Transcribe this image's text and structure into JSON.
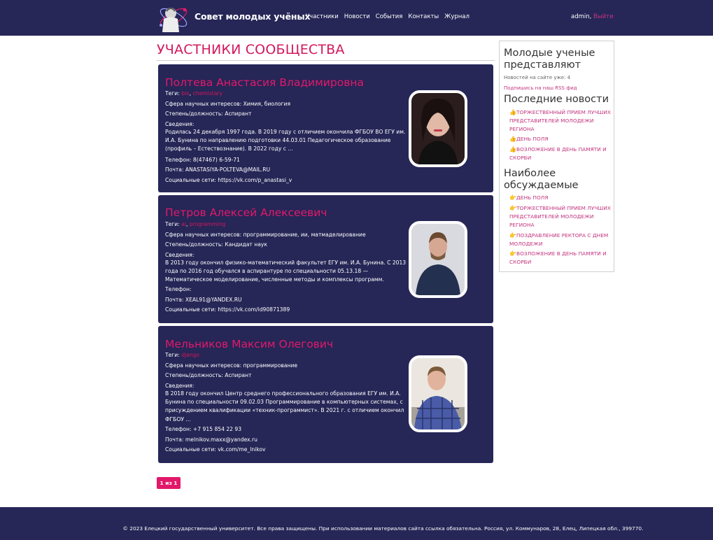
{
  "header": {
    "site_title": "Совет молодых учёных",
    "nav": [
      "Участники",
      "Новости",
      "События",
      "Контакты",
      "Журнал"
    ],
    "user_name": "admin",
    "logout_label": "Выйти"
  },
  "page_title": "УЧАСТНИКИ СООБЩЕСТВА",
  "labels": {
    "tags": "Теги:",
    "field": "Сфера научных интересов:",
    "degree": "Степень/должность:",
    "info": "Сведения:",
    "phone": "Телефон:",
    "email": "Почта:",
    "social": "Социальные сети:"
  },
  "members": [
    {
      "name": "Полтева Анастасия Владимировна",
      "tags": [
        "bio",
        "chemistary"
      ],
      "field": "Химия, биология",
      "degree": "Аспирант",
      "info": "Родилась 24 декабря 1997 года. В 2019 году с отличием окончила ФГБОУ ВО ЕГУ им. И.А. Бунина по направлению подготовки 44.03.01 Педагогическое образование (профиль – Естествознание). В 2022 году с ...",
      "phone": "8(47467) 6-59-71",
      "email": "ANASTASIYA-POLTEVA@MAIL.RU",
      "social": "https://vk.com/p_anastasi_v"
    },
    {
      "name": "Петров Алексей Алексеевич",
      "tags": [
        "ai",
        "programming"
      ],
      "field": "программирование, ии, матмаделирование",
      "degree": "Кандидат наук",
      "info": "В 2013 году окончил физико-математический факультет ЕГУ им. И.А. Бунина. С 2013 года по 2016 год обучался в аспирантуре по специальности 05.13.18 — Математическое моделирование, численные методы и комплексы программ.",
      "phone": "",
      "email": "XEAL91@YANDEX.RU",
      "social": "https://vk.com/id90871389"
    },
    {
      "name": "Мельников Максим Олегович",
      "tags": [
        "django"
      ],
      "field": "программирование",
      "degree": "Аспирант",
      "info": "В 2018 году окончил Центр среднего профессионального образования ЕГУ им. И.А. Бунина по специальности 09.02.03 Программирование в компьютерных системах, с присуждением квалификации «техник-программист». В 2021 г. с отличием окончил ФГБОУ ...",
      "phone": "+7 915 854 22 93",
      "email": "melnikov.maxx@yandex.ru",
      "social": "vk.com/me_lnikov"
    }
  ],
  "pagination": "1 из 1",
  "sidebar": {
    "heading": "Молодые ученые представляют",
    "news_count": "Новостей на сайте уже: 4",
    "rss": "Подпишись на наш RSS фид",
    "latest_heading": "Последние новости",
    "latest": [
      "ТОРЖЕСТВЕННЫЙ ПРИЕМ ЛУЧШИХ ПРЕДСТАВИТЕЛЕЙ МОЛОДЕЖИ РЕГИОНА",
      "ДЕНЬ ПОЛЯ",
      "ВОЗЛОЖЕНИЕ В ДЕНЬ ПАМЯТИ И СКОРБИ"
    ],
    "discussed_heading": "Наиболее обсуждаемые",
    "discussed": [
      "ДЕНЬ ПОЛЯ",
      "ТОРЖЕСТВЕННЫЙ ПРИЕМ ЛУЧШИХ ПРЕДСТАВИТЕЛЕЙ МОЛОДЕЖИ РЕГИОНА",
      "ПОЗДРАВЛЕНИЕ РЕКТОРА С ДНЕМ МОЛОДЕЖИ",
      "ВОЗЛОЖЕНИЕ В ДЕНЬ ПАМЯТИ И СКОРБИ"
    ]
  },
  "footer": "© 2023 Елецкий государственный университет. Все права защищены. При использовании материалов сайта ссылка обязательна. Россия, ул. Коммунаров, 28, Елец, Липецкая обл., 399770.",
  "colors": {
    "navy": "#262657",
    "accent": "#e2196a",
    "link": "#c3357e"
  }
}
